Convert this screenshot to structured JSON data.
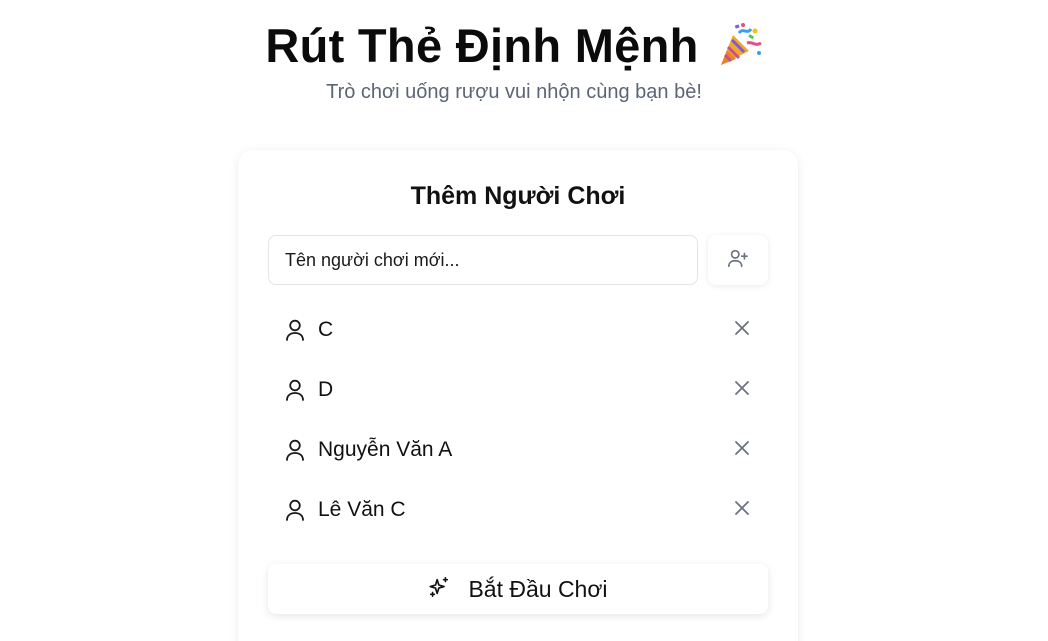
{
  "header": {
    "title": "Rút Thẻ Định Mệnh",
    "title_icon": "party-popper-icon",
    "subtitle": "Trò chơi uống rượu vui nhộn cùng bạn bè!"
  },
  "card": {
    "title": "Thêm Người Chơi",
    "input": {
      "value": "",
      "placeholder": "Tên người chơi mới..."
    },
    "add_button_icon": "user-plus-icon",
    "players": [
      {
        "name": "C",
        "icon": "user-icon",
        "remove_icon": "close-icon"
      },
      {
        "name": "D",
        "icon": "user-icon",
        "remove_icon": "close-icon"
      },
      {
        "name": "Nguyễn Văn A",
        "icon": "user-icon",
        "remove_icon": "close-icon"
      },
      {
        "name": "Lê Văn C",
        "icon": "user-icon",
        "remove_icon": "close-icon"
      }
    ],
    "start_button": {
      "label": "Bắt Đầu Chơi",
      "icon": "sparkles-icon"
    }
  },
  "colors": {
    "background": "#ffffff",
    "subtitle": "#5b6576",
    "icon_gray": "#6b7280",
    "text": "#111111"
  }
}
